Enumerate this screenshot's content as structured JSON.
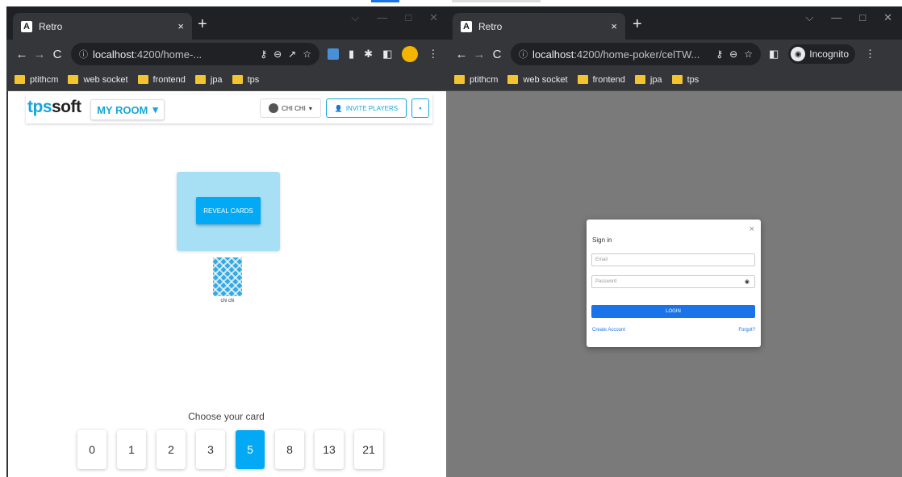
{
  "left_window": {
    "tab": {
      "favicon": "A",
      "title": "Retro",
      "close": "×"
    },
    "new_tab": "+",
    "controls": [
      "⌵",
      "—",
      "□",
      "✕"
    ],
    "url": {
      "info": "ⓘ",
      "host": "localhost",
      "rest": ":4200/home-..."
    },
    "bookmarks": [
      "ptithcm",
      "web socket",
      "frontend",
      "jpa",
      "tps"
    ]
  },
  "right_window": {
    "tab": {
      "favicon": "A",
      "title": "Retro",
      "close": "×"
    },
    "new_tab": "+",
    "controls": [
      "⌵",
      "—",
      "□",
      "✕"
    ],
    "url": {
      "info": "ⓘ",
      "host": "localhost",
      "rest": ":4200/home-poker/celTW..."
    },
    "incognito_label": "Incognito",
    "bookmarks": [
      "ptithcm",
      "web socket",
      "frontend",
      "jpa",
      "tps"
    ]
  },
  "app": {
    "logo_tps": "tps",
    "logo_soft": "soft",
    "room_label": "MY ROOM",
    "room_caret": "▾",
    "user_label": "CHI CHI",
    "user_caret": "▾",
    "invite_label": "INVITE PLAYERS",
    "doc_icon": "▪",
    "reveal_label": "REVEAL CARDS",
    "player_name": "chi chi",
    "choose_label": "Choose your card",
    "cards": [
      "0",
      "1",
      "2",
      "3",
      "5",
      "8",
      "13",
      "21"
    ],
    "selected_card": "5",
    "accent_color": "#03a9f4"
  },
  "signin": {
    "close": "×",
    "title": "Sign in",
    "email_placeholder": "Email",
    "password_placeholder": "Password",
    "login_label": "LOGIN",
    "create_account": "Create Account",
    "forgot": "Forgot?"
  }
}
